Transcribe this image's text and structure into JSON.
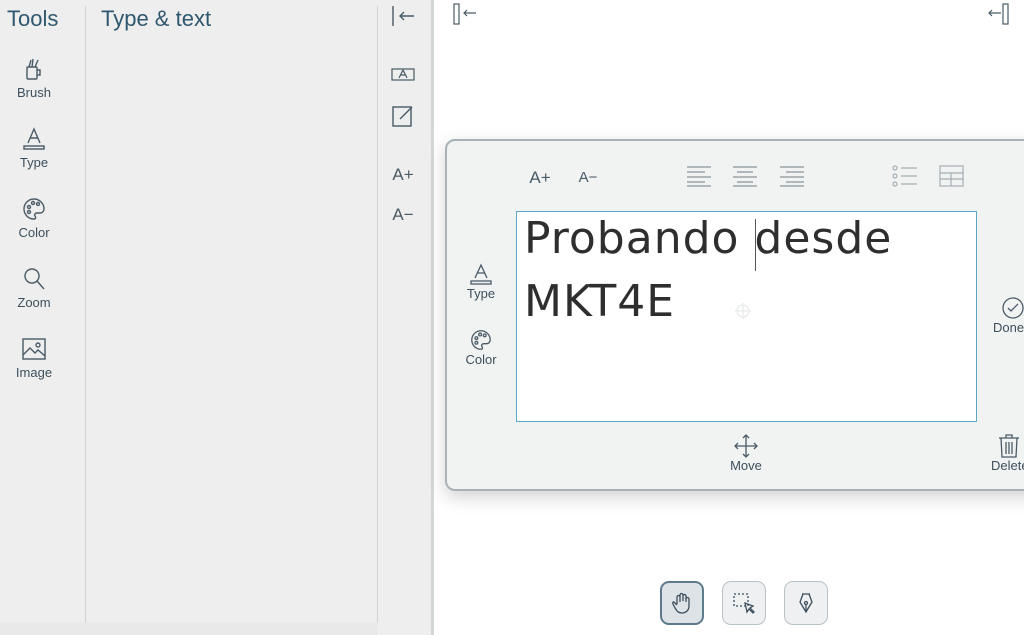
{
  "tools_panel": {
    "title": "Tools",
    "items": [
      {
        "label": "Brush",
        "icon": "brush-icon"
      },
      {
        "label": "Type",
        "icon": "type-icon"
      },
      {
        "label": "Color",
        "icon": "palette-icon"
      },
      {
        "label": "Zoom",
        "icon": "magnifier-icon"
      },
      {
        "label": "Image",
        "icon": "image-icon"
      }
    ]
  },
  "type_panel": {
    "title": "Type & text"
  },
  "side_strip": {
    "collapse_icon": "collapse-left-icon",
    "increase_label": "A+",
    "decrease_label": "A−"
  },
  "editor": {
    "text_lines": [
      "Probando desde",
      "MKT4E"
    ],
    "increase_label": "A+",
    "decrease_label": "A−",
    "left_tools": [
      {
        "label": "Type",
        "icon": "type-icon"
      },
      {
        "label": "Color",
        "icon": "palette-icon"
      }
    ],
    "done_label": "Done",
    "move_label": "Move",
    "delete_label": "Delete"
  },
  "colors": {
    "panel_bg": "#edeeed",
    "title": "#2f5870",
    "text_area_border": "#5aa7c7",
    "card_border": "#a7b2b8"
  },
  "bottom_tools": [
    {
      "name": "hand-tool",
      "icon": "hand-icon",
      "active": true
    },
    {
      "name": "select-tool",
      "icon": "select-area-icon",
      "active": false
    },
    {
      "name": "pen-tool",
      "icon": "pen-nib-icon",
      "active": false
    }
  ]
}
